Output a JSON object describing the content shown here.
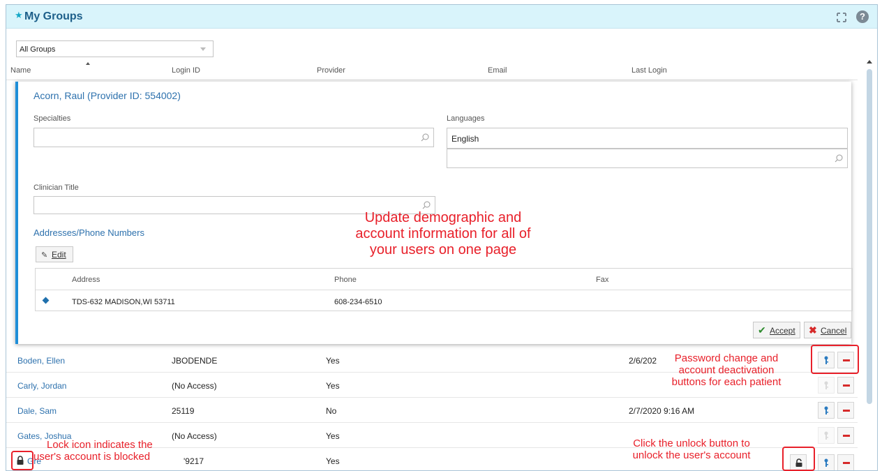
{
  "header": {
    "title": "My Groups",
    "icons": [
      "star-icon",
      "expand-icon",
      "help-icon"
    ]
  },
  "group_filter": {
    "selected": "All Groups"
  },
  "columns": {
    "name": "Name",
    "login_id": "Login ID",
    "provider": "Provider",
    "email": "Email",
    "last_login": "Last Login"
  },
  "editor": {
    "name": "Acorn, Raul (Provider ID: 554002)",
    "specialties_label": "Specialties",
    "specialties_value": "",
    "languages_label": "Languages",
    "languages_selected": "English",
    "languages_value": "",
    "clinician_title_label": "Clinician Title",
    "clinician_title_value": "",
    "addresses_heading": "Addresses/Phone Numbers",
    "edit_label": "Edit",
    "address_table": {
      "headers": {
        "address": "Address",
        "phone": "Phone",
        "fax": "Fax"
      },
      "row": {
        "address": "TDS-632 MADISON,WI 53711",
        "phone": "608-234-6510",
        "fax": ""
      }
    },
    "accept_label": "Accept",
    "cancel_label": "Cancel"
  },
  "rows": [
    {
      "name": "Boden, Ellen",
      "login_id": "JBODENDE",
      "provider": "Yes",
      "last_login": "2/6/202"
    },
    {
      "name": "Carly, Jordan",
      "login_id": "(No Access)",
      "provider": "Yes",
      "last_login": ""
    },
    {
      "name": "Dale, Sam",
      "login_id": "25119",
      "provider": "No",
      "last_login": "2/7/2020 9:16 AM"
    },
    {
      "name_first": "Gates,",
      "name_rest": "Joshua",
      "login_prefix": "(No",
      "login_rest": "Access)",
      "provider": "Yes",
      "last_login": ""
    },
    {
      "name_fragment": "Gre",
      "login_fragment": "'9217",
      "provider": "Yes"
    }
  ],
  "annotations": {
    "main_line1": "Update demographic and",
    "main_line2": "account information for all of",
    "main_line3": "your users on one page",
    "password_line1": "Password change and",
    "password_line2": "account deactivation",
    "password_line3": "buttons for each patient",
    "lock_line1": "Lock icon indicates the",
    "lock_line2": "user's account is blocked",
    "unlock_line1": "Click the unlock button to",
    "unlock_line2": "unlock the user's account"
  },
  "colors": {
    "accent": "#1f8ed8",
    "link": "#2d71ad",
    "annotation": "#e8202a",
    "deactivate": "#d62a2a"
  }
}
